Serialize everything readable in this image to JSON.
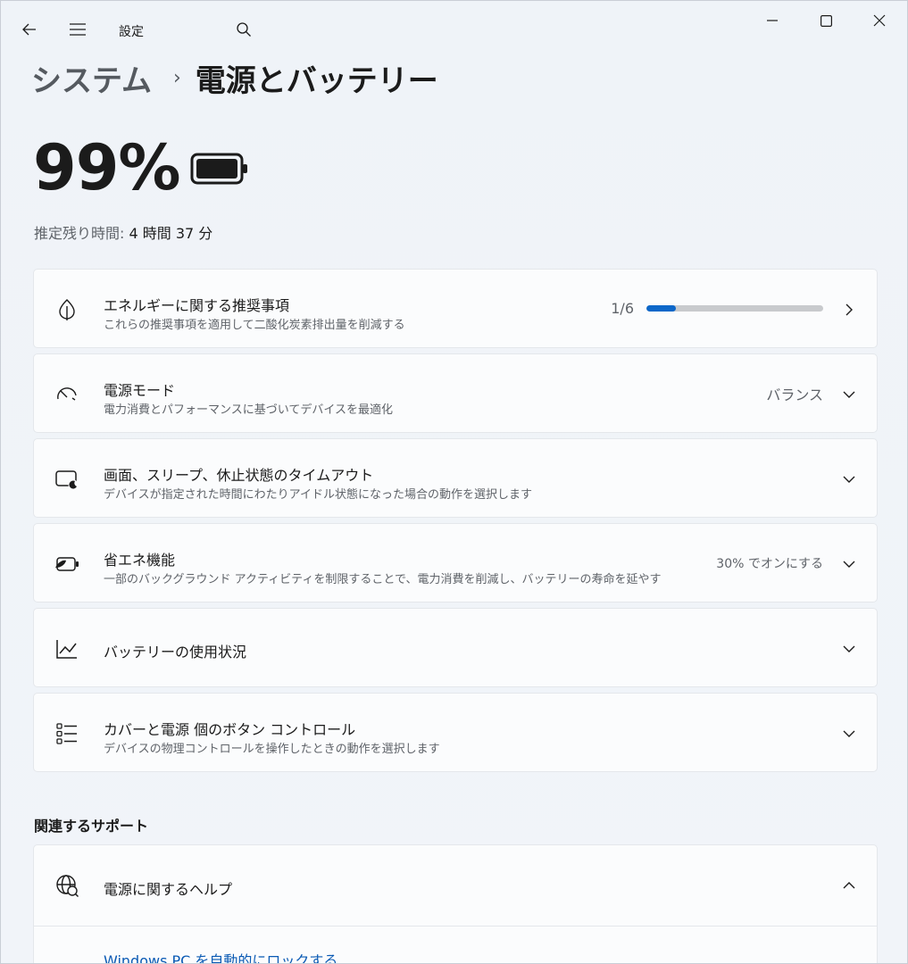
{
  "titlebar": {
    "app_title": "設定",
    "back_icon": "back-arrow-icon",
    "menu_icon": "hamburger-menu-icon",
    "search_icon": "search-icon"
  },
  "breadcrumb": {
    "parent": "システム",
    "separator": "›",
    "current": "電源とバッテリー"
  },
  "battery": {
    "percent_text": "99%",
    "remaining_label": "推定残り時間:",
    "remaining_value": "4 時間 37 分"
  },
  "cards": [
    {
      "title": "エネルギーに関する推奨事項",
      "subtitle": "これらの推奨事項を適用して二酸化炭素排出量を削減する",
      "value": "1/6",
      "progress_fraction": 0.167,
      "icon": "leaf-icon"
    },
    {
      "title": "電源モード",
      "subtitle": "電力消費とパフォーマンスに基づいてデバイスを最適化",
      "value": "バランス",
      "icon": "speedometer-icon"
    },
    {
      "title": "画面、スリープ、休止状態のタイムアウト",
      "subtitle": "デバイスが指定された時間にわたりアイドル状態になった場合の動作を選択します",
      "icon": "screen-sleep-icon"
    },
    {
      "title": "省エネ機能",
      "subtitle": "一部のバックグラウンド アクティビティを制限することで、電力消費を削減し、バッテリーの寿命を延やす",
      "value": "30% でオンにする",
      "icon": "battery-saver-icon"
    },
    {
      "title": "バッテリーの使用状況",
      "icon": "line-chart-icon"
    },
    {
      "title": "カバーと電源 個のボタン コントロール",
      "subtitle": "デバイスの物理コントロールを操作したときの動作を選択します",
      "icon": "list-icon"
    }
  ],
  "related": {
    "section_title": "関連するサポート",
    "help_title": "電源に関するヘルプ",
    "help_icon": "globe-help-icon",
    "help_link": "Windows PC を自動的にロックする"
  },
  "colors": {
    "accent": "#0c67c9",
    "link": "#0a5ab4",
    "background": "#eef2f7",
    "card": "#fbfcfd"
  }
}
